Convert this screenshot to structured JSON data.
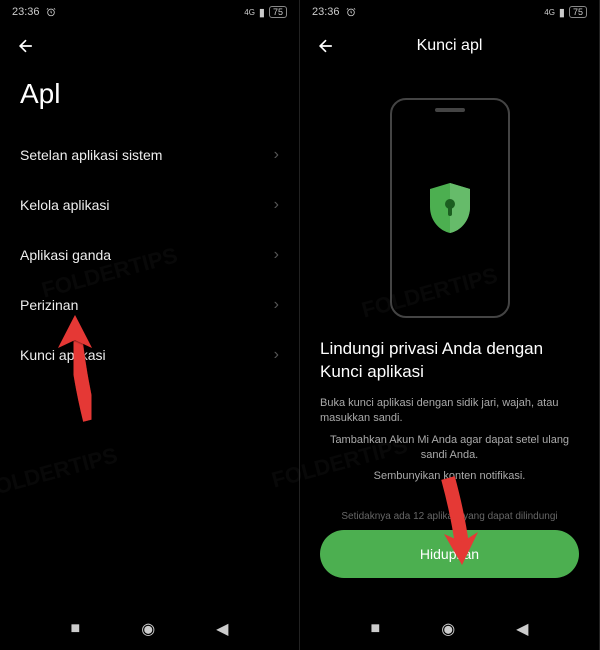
{
  "status": {
    "time": "23:36",
    "battery": "75",
    "signal": "4G"
  },
  "screen1": {
    "title": "Apl",
    "items": [
      {
        "label": "Setelan aplikasi sistem"
      },
      {
        "label": "Kelola aplikasi"
      },
      {
        "label": "Aplikasi ganda"
      },
      {
        "label": "Perizinan"
      },
      {
        "label": "Kunci aplikasi"
      }
    ]
  },
  "screen2": {
    "header": "Kunci apl",
    "promoTitle": "Lindungi privasi Anda dengan Kunci aplikasi",
    "promoLine1": "Buka kunci aplikasi dengan sidik jari, wajah, atau masukkan sandi.",
    "promoLine2": "Tambahkan Akun Mi Anda agar dapat setel ulang sandi Anda.",
    "promoLine3": "Sembunyikan konten notifikasi.",
    "hint": "Setidaknya ada 12 aplikasi yang dapat dilindungi",
    "cta": "Hidupkan"
  },
  "colors": {
    "accent": "#4caf50",
    "arrow": "#e53935"
  }
}
